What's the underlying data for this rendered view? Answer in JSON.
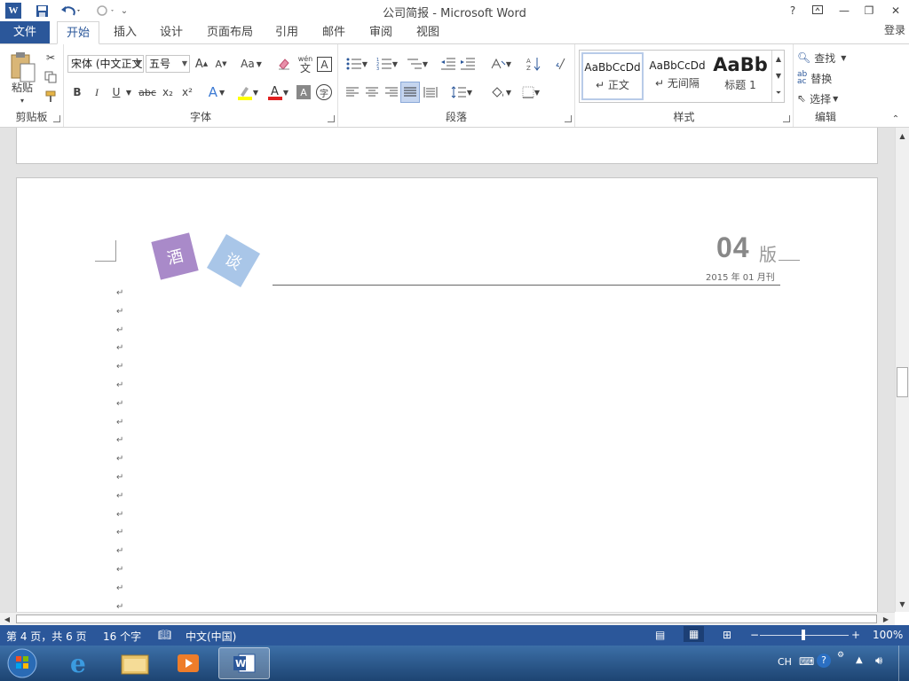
{
  "window": {
    "title": "公司简报 - Microsoft Word",
    "help": "?",
    "login": "登录"
  },
  "qat": {
    "save_icon": "save-icon",
    "undo_icon": "undo-icon",
    "redo_icon": "redo-icon"
  },
  "tabs": [
    {
      "label": "文件"
    },
    {
      "label": "开始"
    },
    {
      "label": "插入"
    },
    {
      "label": "设计"
    },
    {
      "label": "页面布局"
    },
    {
      "label": "引用"
    },
    {
      "label": "邮件"
    },
    {
      "label": "审阅"
    },
    {
      "label": "视图"
    }
  ],
  "ribbon": {
    "clipboard": {
      "label": "剪贴板",
      "paste": "粘贴"
    },
    "font": {
      "label": "字体",
      "name": "宋体 (中文正文)",
      "size": "五号",
      "change_case": "Aa",
      "bold": "B",
      "italic": "I",
      "underline": "U",
      "strike": "abc",
      "sub": "x₂",
      "sup": "x²",
      "pinyin_top": "wén",
      "pinyin_bottom": "文",
      "border_char": "A",
      "circle_char": "字"
    },
    "paragraph": {
      "label": "段落"
    },
    "styles": {
      "label": "样式",
      "items": [
        {
          "preview": "AaBbCcDd",
          "name": "正文"
        },
        {
          "preview": "AaBbCcDd",
          "name": "无间隔"
        },
        {
          "preview": "AaBb",
          "name": "标题 1"
        }
      ]
    },
    "editing": {
      "label": "编辑",
      "find": "查找",
      "replace": "替换",
      "select": "选择"
    }
  },
  "document": {
    "diamond1": "酒",
    "diamond2": "谈",
    "edition_number": "04",
    "edition_suffix": "版",
    "date": "2015 年 01 月刊",
    "pilcrow": "↵"
  },
  "status": {
    "page": "第 4 页，共 6 页",
    "words": "16 个字",
    "language": "中文(中国)",
    "zoom": "100%"
  },
  "taskbar": {
    "ime": "CH"
  },
  "colors": {
    "accent": "#2b579a",
    "diamond1": "#a989c8",
    "diamond2": "#a9c6e8"
  }
}
